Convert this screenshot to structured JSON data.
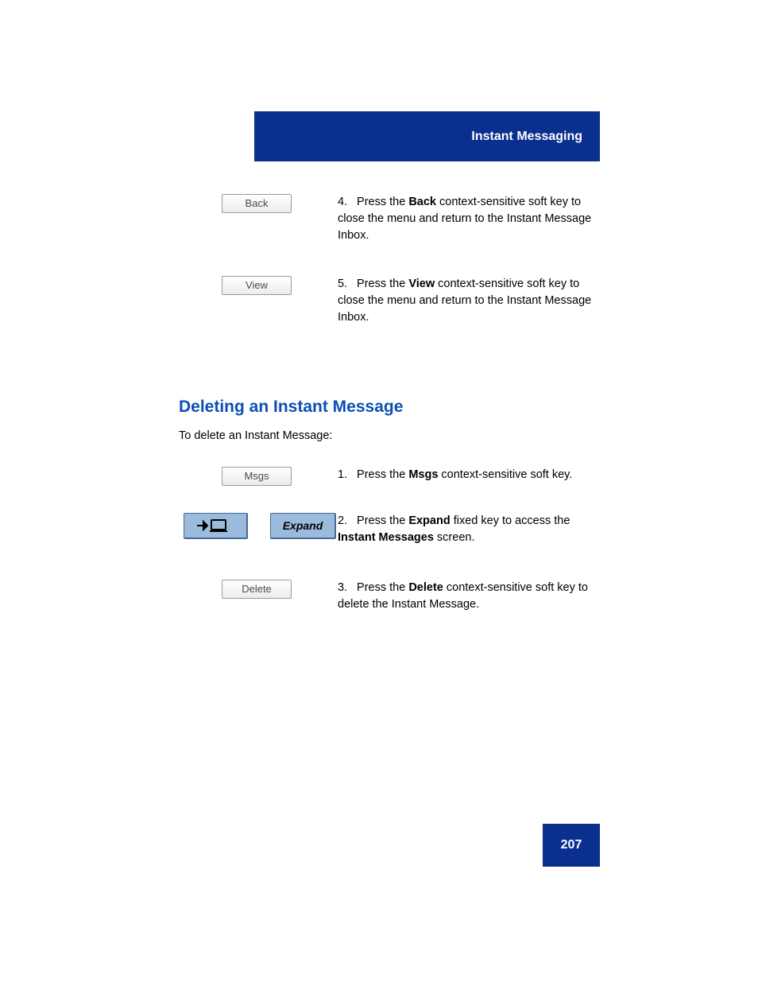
{
  "header": {
    "section_title": "Instant Messaging"
  },
  "steps_top": [
    {
      "key_label": "Back",
      "num": "4.",
      "text_parts": [
        "Press the ",
        " context-sensitive soft key to close the menu and return to the Instant Message Inbox."
      ]
    },
    {
      "key_label": "View",
      "num": "5.",
      "text_parts": [
        "Press the ",
        " context-sensitive soft key to close the menu and return to the Instant Message Inbox."
      ]
    }
  ],
  "delete_section": {
    "heading": "Deleting an Instant Message",
    "intro": "To delete an Instant Message:",
    "steps": [
      {
        "type": "softkey",
        "key_label": "Msgs",
        "num": "1.",
        "text_parts": [
          "Press the ",
          " context-sensitive soft key."
        ]
      },
      {
        "type": "expandkeys",
        "key2_label": "Expand",
        "num": "2.",
        "text_parts": [
          "Press the ",
          " fixed key to access the ",
          " screen."
        ],
        "bold_word": "Expand",
        "bold_screen": "Instant Messages"
      },
      {
        "type": "softkey",
        "key_label": "Delete",
        "num": "3.",
        "text_parts": [
          "Press the ",
          " context-sensitive soft key to delete the Instant Message."
        ]
      }
    ]
  },
  "page_number": "207"
}
